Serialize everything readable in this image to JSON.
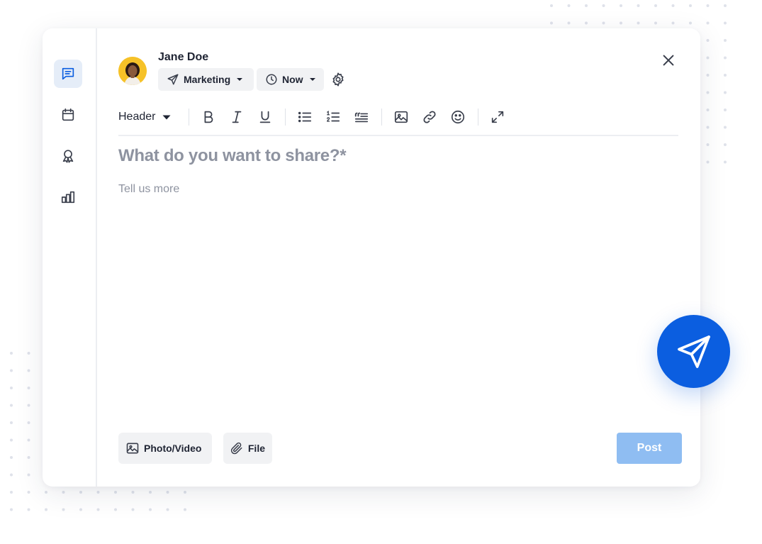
{
  "user": {
    "name": "Jane Doe"
  },
  "audience": {
    "label": "Marketing",
    "icon": "paper-plane-icon"
  },
  "schedule": {
    "label": "Now",
    "icon": "clock-icon"
  },
  "toolbar": {
    "text_style": "Header"
  },
  "composer": {
    "title_placeholder": "What do you want to share?*",
    "body_placeholder": "Tell us more"
  },
  "attachments": {
    "photo_video": "Photo/Video",
    "file": "File"
  },
  "post": {
    "label": "Post"
  },
  "sidebar": {
    "items": [
      {
        "name": "posts",
        "icon": "chat-icon",
        "active": true
      },
      {
        "name": "events",
        "icon": "calendar-icon",
        "active": false
      },
      {
        "name": "awards",
        "icon": "award-icon",
        "active": false
      },
      {
        "name": "analytics",
        "icon": "bar-chart-icon",
        "active": false
      }
    ]
  },
  "colors": {
    "accent": "#0b5ee0",
    "post_button": "#8fbdf2",
    "active_rail": "#e5edf8",
    "placeholder": "#8e93a0"
  }
}
